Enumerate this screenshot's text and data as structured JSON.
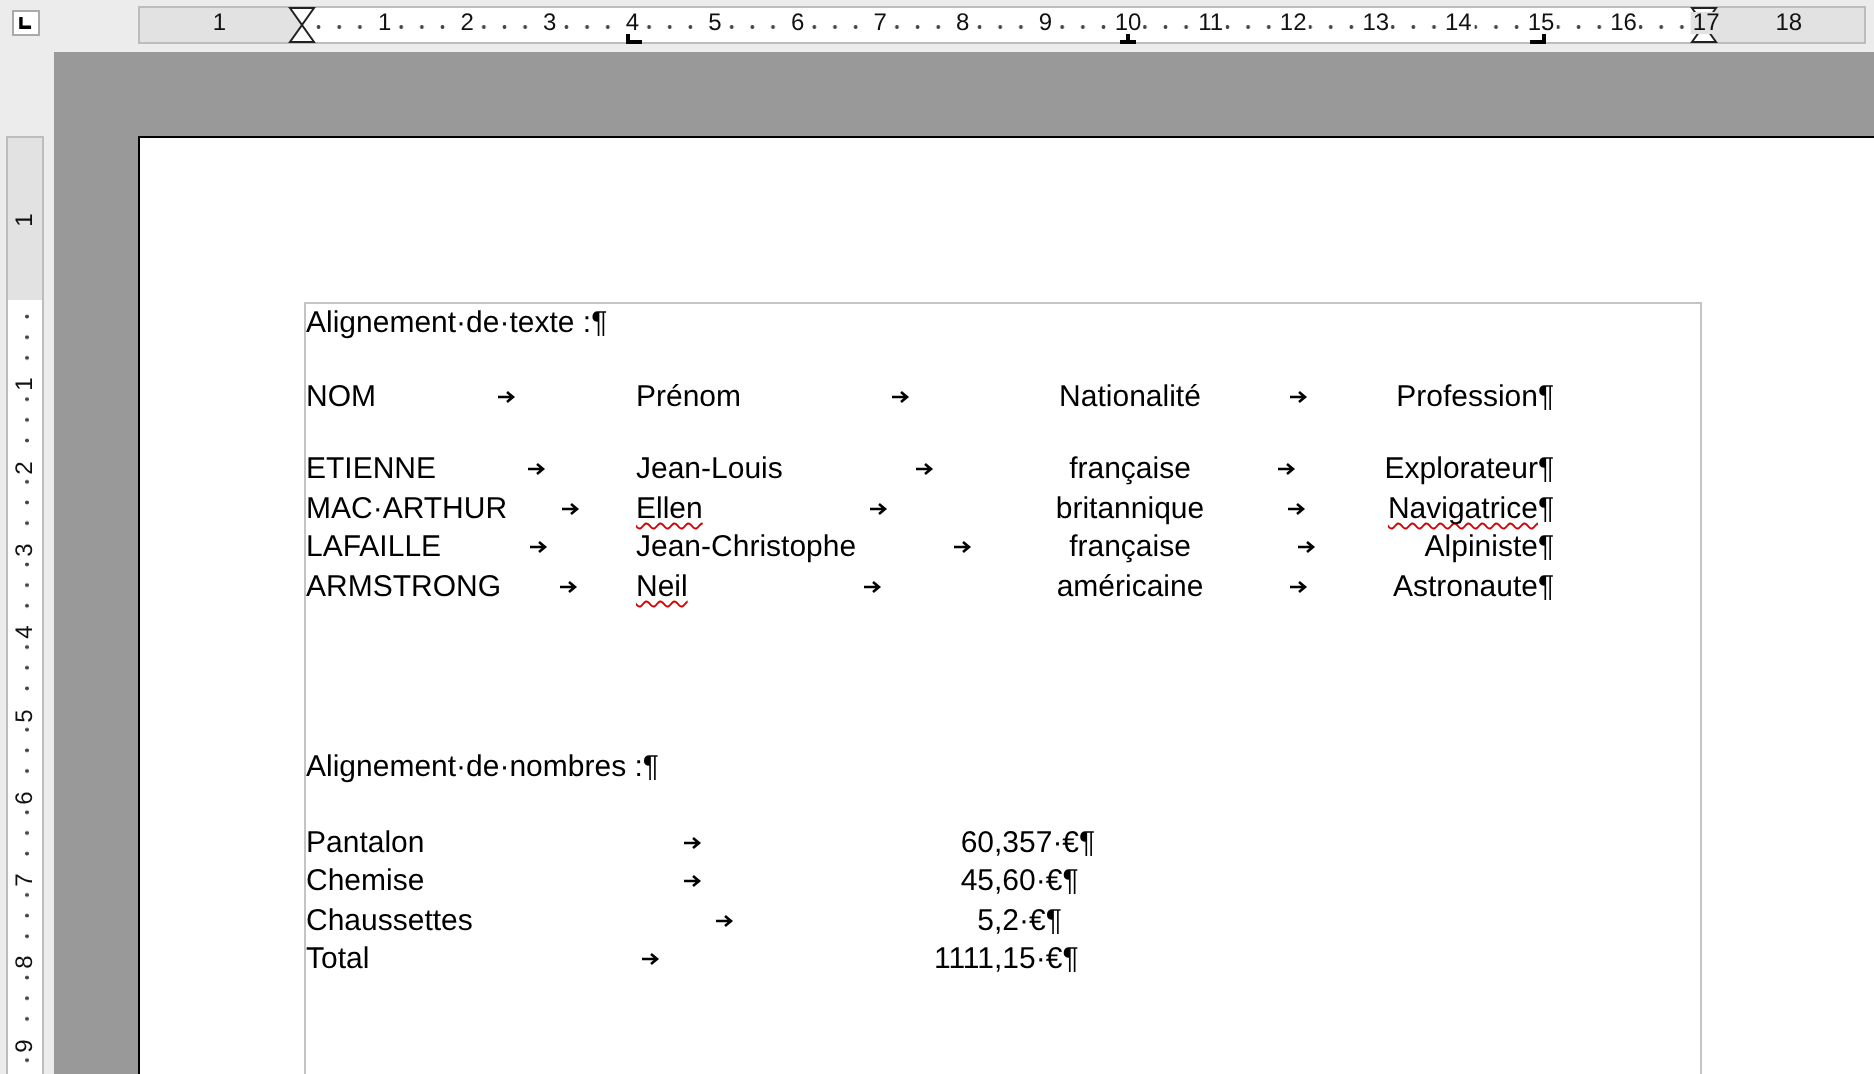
{
  "ruler": {
    "top_margin_labels": [
      "1"
    ],
    "top_labels": [
      "1",
      "2",
      "3",
      "4",
      "5",
      "6",
      "7",
      "8",
      "9",
      "10",
      "11",
      "12",
      "13",
      "14",
      "15",
      "16",
      "17",
      "18"
    ],
    "left_margin_labels": [
      "1"
    ],
    "left_labels": [
      "1",
      "2",
      "3",
      "4",
      "5",
      "6",
      "7",
      "8",
      "9"
    ],
    "tab_stops": [
      {
        "kind": "left"
      },
      {
        "kind": "center"
      },
      {
        "kind": "right"
      }
    ]
  },
  "document": {
    "sections": [
      {
        "kind": "text",
        "heading": "Alignement·de·texte :¶",
        "rows": [
          {
            "kind": "header",
            "cells": [
              {
                "text": "NOM",
                "misspelled": false
              },
              {
                "text": "Prénom",
                "misspelled": false
              },
              {
                "text": "Nationalité",
                "misspelled": false
              },
              {
                "text": "Profession",
                "misspelled": false
              }
            ],
            "mark": "¶"
          },
          {
            "kind": "body",
            "cells": [
              {
                "text": "ETIENNE",
                "misspelled": false
              },
              {
                "text": "Jean-Louis",
                "misspelled": false
              },
              {
                "text": "française",
                "misspelled": false
              },
              {
                "text": "Explorateur",
                "misspelled": false
              }
            ],
            "mark": "¶"
          },
          {
            "kind": "body",
            "cells": [
              {
                "text": "MAC·ARTHUR",
                "misspelled": false
              },
              {
                "text": "Ellen",
                "misspelled": true
              },
              {
                "text": "britannique",
                "misspelled": false
              },
              {
                "text": "Navigatrice",
                "misspelled": true
              }
            ],
            "mark": "¶"
          },
          {
            "kind": "body",
            "cells": [
              {
                "text": "LAFAILLE",
                "misspelled": false
              },
              {
                "text": "Jean-Christophe",
                "misspelled": false
              },
              {
                "text": "française",
                "misspelled": false
              },
              {
                "text": "Alpiniste",
                "misspelled": false
              }
            ],
            "mark": "¶"
          },
          {
            "kind": "body",
            "cells": [
              {
                "text": "ARMSTRONG",
                "misspelled": false
              },
              {
                "text": "Neil",
                "misspelled": true
              },
              {
                "text": "américaine",
                "misspelled": false
              },
              {
                "text": "Astronaute",
                "misspelled": false
              }
            ],
            "mark": "¶"
          }
        ]
      },
      {
        "kind": "numbers",
        "heading": "Alignement·de·nombres :¶",
        "rows": [
          {
            "kind": "body",
            "cells": [
              {
                "text": "Pantalon",
                "misspelled": false
              },
              {
                "text": "60,357·€",
                "misspelled": false
              }
            ],
            "mark": "¶"
          },
          {
            "kind": "body",
            "cells": [
              {
                "text": "Chemise",
                "misspelled": false
              },
              {
                "text": "45,60·€",
                "misspelled": false
              }
            ],
            "mark": "¶"
          },
          {
            "kind": "body",
            "cells": [
              {
                "text": "Chaussettes",
                "misspelled": false
              },
              {
                "text": "5,2·€",
                "misspelled": false
              }
            ],
            "mark": "¶"
          },
          {
            "kind": "body",
            "cells": [
              {
                "text": "Total",
                "misspelled": false
              },
              {
                "text": "1111,15·€",
                "misspelled": false
              }
            ],
            "mark": "¶"
          }
        ]
      }
    ]
  }
}
